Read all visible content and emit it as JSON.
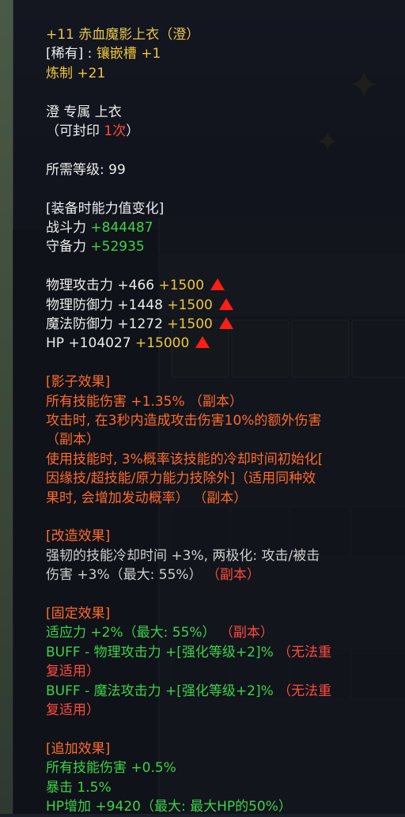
{
  "item": {
    "name": "+11 赤血魔影上衣（澄）",
    "rarity_prefix": "[稀有] : ",
    "rarity_value": "镶嵌槽 +1",
    "refine_label": "炼制 ",
    "refine_value": "+21",
    "class_line": "澄 专属 上衣",
    "seal_prefix": "（可封印 ",
    "seal_count": "1次",
    "seal_suffix": "）",
    "level_req": "所需等级: 99"
  },
  "power_change": {
    "header": "[装备时能力值变化]",
    "rows": [
      {
        "label": "战斗力 ",
        "value": "+844487"
      },
      {
        "label": "守备力 ",
        "value": "+52935"
      }
    ]
  },
  "stats": [
    {
      "label": "物理攻击力 +466 ",
      "bonus": "+1500"
    },
    {
      "label": "物理防御力 +1448 ",
      "bonus": "+1500"
    },
    {
      "label": "魔法防御力 +1272 ",
      "bonus": "+1500"
    },
    {
      "label": "HP +104027 ",
      "bonus": "+15000"
    }
  ],
  "shadow": {
    "header": "[影子效果]",
    "lines": [
      "所有技能伤害 +1.35% （副本）",
      "攻击时, 在3秒内造成攻击伤害10%的额外伤害",
      "（副本）",
      "使用技能时, 3%概率该技能的冷却时间初始化[",
      "因缘技/超技能/原力能力技除外]（适用同种效",
      "果时, 会增加发动概率） （副本）"
    ]
  },
  "modify": {
    "header": "[改造效果]",
    "line1": "强韧的技能冷却时间 +3%, 两极化: 攻击/被击",
    "line2_text": "伤害 +3%（最大: 55%） ",
    "line2_tag": "（副本）"
  },
  "fixed": {
    "header": "[固定效果]",
    "l1_text": "适应力 +2%（最大: 55%） ",
    "l1_tag": "（副本）",
    "l2_text": "BUFF - 物理攻击力 +[强化等级+2]% ",
    "l2_tag": "（无法重",
    "l3_tag": "复适用）",
    "l4_text": "BUFF - 魔法攻击力 +[强化等级+2]% ",
    "l4_tag": "（无法重",
    "l5_tag": "复适用）"
  },
  "extra": {
    "header": "[追加效果]",
    "lines": [
      "所有技能伤害 +0.5%",
      "暴击 1.5%",
      "HP增加 +9420（最大: 最大HP的50%）"
    ]
  },
  "icons": {
    "stat_up": "red-up-triangle-icon"
  },
  "colors": {
    "title": "#e8c44b",
    "text": "#ececec",
    "green": "#3ed24a",
    "bonus": "#f0c53a",
    "red": "#ff4a3d",
    "effect": "#ff6a2c"
  }
}
